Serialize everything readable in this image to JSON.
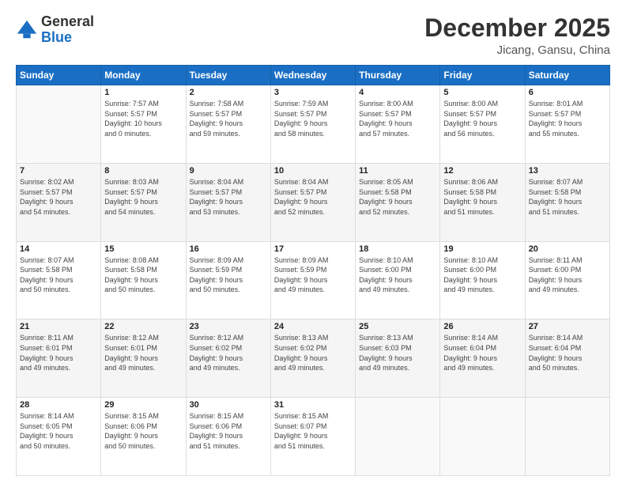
{
  "header": {
    "logo_general": "General",
    "logo_blue": "Blue",
    "month_title": "December 2025",
    "location": "Jicang, Gansu, China"
  },
  "days_of_week": [
    "Sunday",
    "Monday",
    "Tuesday",
    "Wednesday",
    "Thursday",
    "Friday",
    "Saturday"
  ],
  "weeks": [
    [
      {
        "day": "",
        "info": ""
      },
      {
        "day": "1",
        "info": "Sunrise: 7:57 AM\nSunset: 5:57 PM\nDaylight: 10 hours\nand 0 minutes."
      },
      {
        "day": "2",
        "info": "Sunrise: 7:58 AM\nSunset: 5:57 PM\nDaylight: 9 hours\nand 59 minutes."
      },
      {
        "day": "3",
        "info": "Sunrise: 7:59 AM\nSunset: 5:57 PM\nDaylight: 9 hours\nand 58 minutes."
      },
      {
        "day": "4",
        "info": "Sunrise: 8:00 AM\nSunset: 5:57 PM\nDaylight: 9 hours\nand 57 minutes."
      },
      {
        "day": "5",
        "info": "Sunrise: 8:00 AM\nSunset: 5:57 PM\nDaylight: 9 hours\nand 56 minutes."
      },
      {
        "day": "6",
        "info": "Sunrise: 8:01 AM\nSunset: 5:57 PM\nDaylight: 9 hours\nand 55 minutes."
      }
    ],
    [
      {
        "day": "7",
        "info": "Sunrise: 8:02 AM\nSunset: 5:57 PM\nDaylight: 9 hours\nand 54 minutes."
      },
      {
        "day": "8",
        "info": "Sunrise: 8:03 AM\nSunset: 5:57 PM\nDaylight: 9 hours\nand 54 minutes."
      },
      {
        "day": "9",
        "info": "Sunrise: 8:04 AM\nSunset: 5:57 PM\nDaylight: 9 hours\nand 53 minutes."
      },
      {
        "day": "10",
        "info": "Sunrise: 8:04 AM\nSunset: 5:57 PM\nDaylight: 9 hours\nand 52 minutes."
      },
      {
        "day": "11",
        "info": "Sunrise: 8:05 AM\nSunset: 5:58 PM\nDaylight: 9 hours\nand 52 minutes."
      },
      {
        "day": "12",
        "info": "Sunrise: 8:06 AM\nSunset: 5:58 PM\nDaylight: 9 hours\nand 51 minutes."
      },
      {
        "day": "13",
        "info": "Sunrise: 8:07 AM\nSunset: 5:58 PM\nDaylight: 9 hours\nand 51 minutes."
      }
    ],
    [
      {
        "day": "14",
        "info": "Sunrise: 8:07 AM\nSunset: 5:58 PM\nDaylight: 9 hours\nand 50 minutes."
      },
      {
        "day": "15",
        "info": "Sunrise: 8:08 AM\nSunset: 5:58 PM\nDaylight: 9 hours\nand 50 minutes."
      },
      {
        "day": "16",
        "info": "Sunrise: 8:09 AM\nSunset: 5:59 PM\nDaylight: 9 hours\nand 50 minutes."
      },
      {
        "day": "17",
        "info": "Sunrise: 8:09 AM\nSunset: 5:59 PM\nDaylight: 9 hours\nand 49 minutes."
      },
      {
        "day": "18",
        "info": "Sunrise: 8:10 AM\nSunset: 6:00 PM\nDaylight: 9 hours\nand 49 minutes."
      },
      {
        "day": "19",
        "info": "Sunrise: 8:10 AM\nSunset: 6:00 PM\nDaylight: 9 hours\nand 49 minutes."
      },
      {
        "day": "20",
        "info": "Sunrise: 8:11 AM\nSunset: 6:00 PM\nDaylight: 9 hours\nand 49 minutes."
      }
    ],
    [
      {
        "day": "21",
        "info": "Sunrise: 8:11 AM\nSunset: 6:01 PM\nDaylight: 9 hours\nand 49 minutes."
      },
      {
        "day": "22",
        "info": "Sunrise: 8:12 AM\nSunset: 6:01 PM\nDaylight: 9 hours\nand 49 minutes."
      },
      {
        "day": "23",
        "info": "Sunrise: 8:12 AM\nSunset: 6:02 PM\nDaylight: 9 hours\nand 49 minutes."
      },
      {
        "day": "24",
        "info": "Sunrise: 8:13 AM\nSunset: 6:02 PM\nDaylight: 9 hours\nand 49 minutes."
      },
      {
        "day": "25",
        "info": "Sunrise: 8:13 AM\nSunset: 6:03 PM\nDaylight: 9 hours\nand 49 minutes."
      },
      {
        "day": "26",
        "info": "Sunrise: 8:14 AM\nSunset: 6:04 PM\nDaylight: 9 hours\nand 49 minutes."
      },
      {
        "day": "27",
        "info": "Sunrise: 8:14 AM\nSunset: 6:04 PM\nDaylight: 9 hours\nand 50 minutes."
      }
    ],
    [
      {
        "day": "28",
        "info": "Sunrise: 8:14 AM\nSunset: 6:05 PM\nDaylight: 9 hours\nand 50 minutes."
      },
      {
        "day": "29",
        "info": "Sunrise: 8:15 AM\nSunset: 6:06 PM\nDaylight: 9 hours\nand 50 minutes."
      },
      {
        "day": "30",
        "info": "Sunrise: 8:15 AM\nSunset: 6:06 PM\nDaylight: 9 hours\nand 51 minutes."
      },
      {
        "day": "31",
        "info": "Sunrise: 8:15 AM\nSunset: 6:07 PM\nDaylight: 9 hours\nand 51 minutes."
      },
      {
        "day": "",
        "info": ""
      },
      {
        "day": "",
        "info": ""
      },
      {
        "day": "",
        "info": ""
      }
    ]
  ]
}
